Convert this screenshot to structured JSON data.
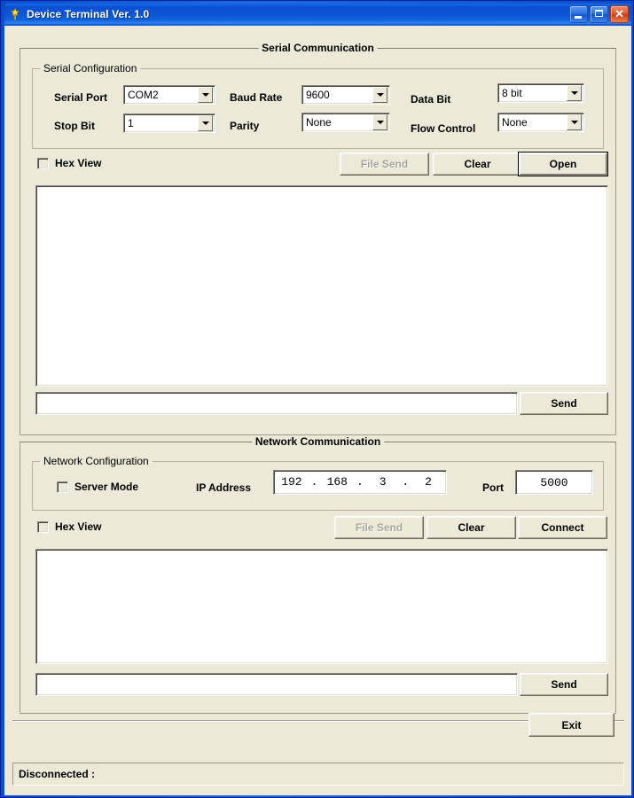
{
  "window": {
    "title": "Device Terminal Ver. 1.0",
    "icon": "pushpin-icon",
    "controls": {
      "minimize": "minimize-button",
      "maximize": "maximize-button",
      "close": "close-button",
      "close_glyph": "✕"
    },
    "colors": {
      "titlebar_blue": "#0a51d2",
      "dialog_face": "#ece9d8",
      "field_white": "#ffffff",
      "close_red": "#e15a32"
    }
  },
  "serial": {
    "group_title": "Serial Communication",
    "config": {
      "group_title": "Serial Configuration",
      "fields": [
        {
          "label": "Serial Port",
          "value": "COM2"
        },
        {
          "label": "Baud Rate",
          "value": "9600"
        },
        {
          "label": "Data Bit",
          "value": "8 bit"
        },
        {
          "label": "Stop Bit",
          "value": "1"
        },
        {
          "label": "Parity",
          "value": "None"
        },
        {
          "label": "Flow Control",
          "value": "None"
        }
      ]
    },
    "hex_view": {
      "label": "Hex View",
      "checked": false
    },
    "buttons": {
      "file_send": "File Send",
      "clear": "Clear",
      "open": "Open"
    },
    "log": "",
    "send_input": {
      "value": "",
      "placeholder": ""
    },
    "send_button": "Send"
  },
  "network": {
    "group_title": "Network Communication",
    "config": {
      "group_title": "Network Configuration",
      "server_mode": {
        "label": "Server Mode",
        "checked": false
      },
      "ip_label": "IP Address",
      "ip_octets": [
        "192",
        "168",
        "3",
        "2"
      ],
      "ip_separator": ".",
      "port_label": "Port",
      "port_value": "5000"
    },
    "hex_view": {
      "label": "Hex View",
      "checked": false
    },
    "buttons": {
      "file_send": "File Send",
      "clear": "Clear",
      "connect": "Connect"
    },
    "log": "",
    "send_input": {
      "value": "",
      "placeholder": ""
    },
    "send_button": "Send"
  },
  "footer": {
    "exit_button": "Exit",
    "status": "Disconnected :"
  }
}
